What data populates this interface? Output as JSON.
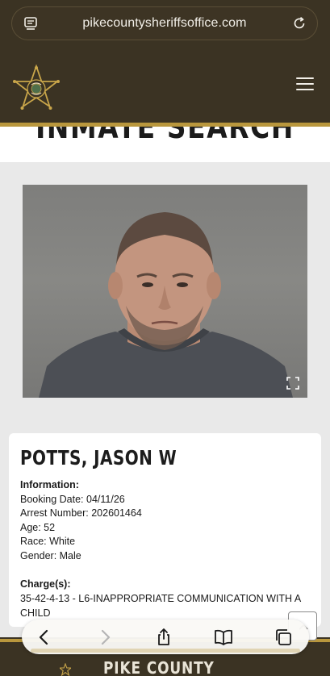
{
  "browser": {
    "url": "pikecountysheriffsoffice.com",
    "icons": [
      "tabs-overview-icon",
      "reload-icon"
    ]
  },
  "site": {
    "page_title": "INMATE SEARCH",
    "footer_name": "PIKE COUNTY",
    "colors": {
      "header_bg": "#3b3323",
      "gold": "#b9973d"
    }
  },
  "inmate": {
    "name": "POTTS, JASON W",
    "information_label": "Information:",
    "booking_date": "Booking Date: 04/11/26",
    "arrest_number": "Arrest Number: 202601464",
    "age": "Age: 52",
    "race": "Race: White",
    "gender": "Gender: Male",
    "charges_label": "Charge(s):",
    "charges": [
      "35-42-4-13 - L6-INAPPROPRIATE COMMUNICATION WITH A CHILD"
    ]
  },
  "toolbar": {
    "icons": [
      "back-icon",
      "forward-icon",
      "share-icon",
      "bookmarks-icon",
      "tabs-icon"
    ]
  }
}
